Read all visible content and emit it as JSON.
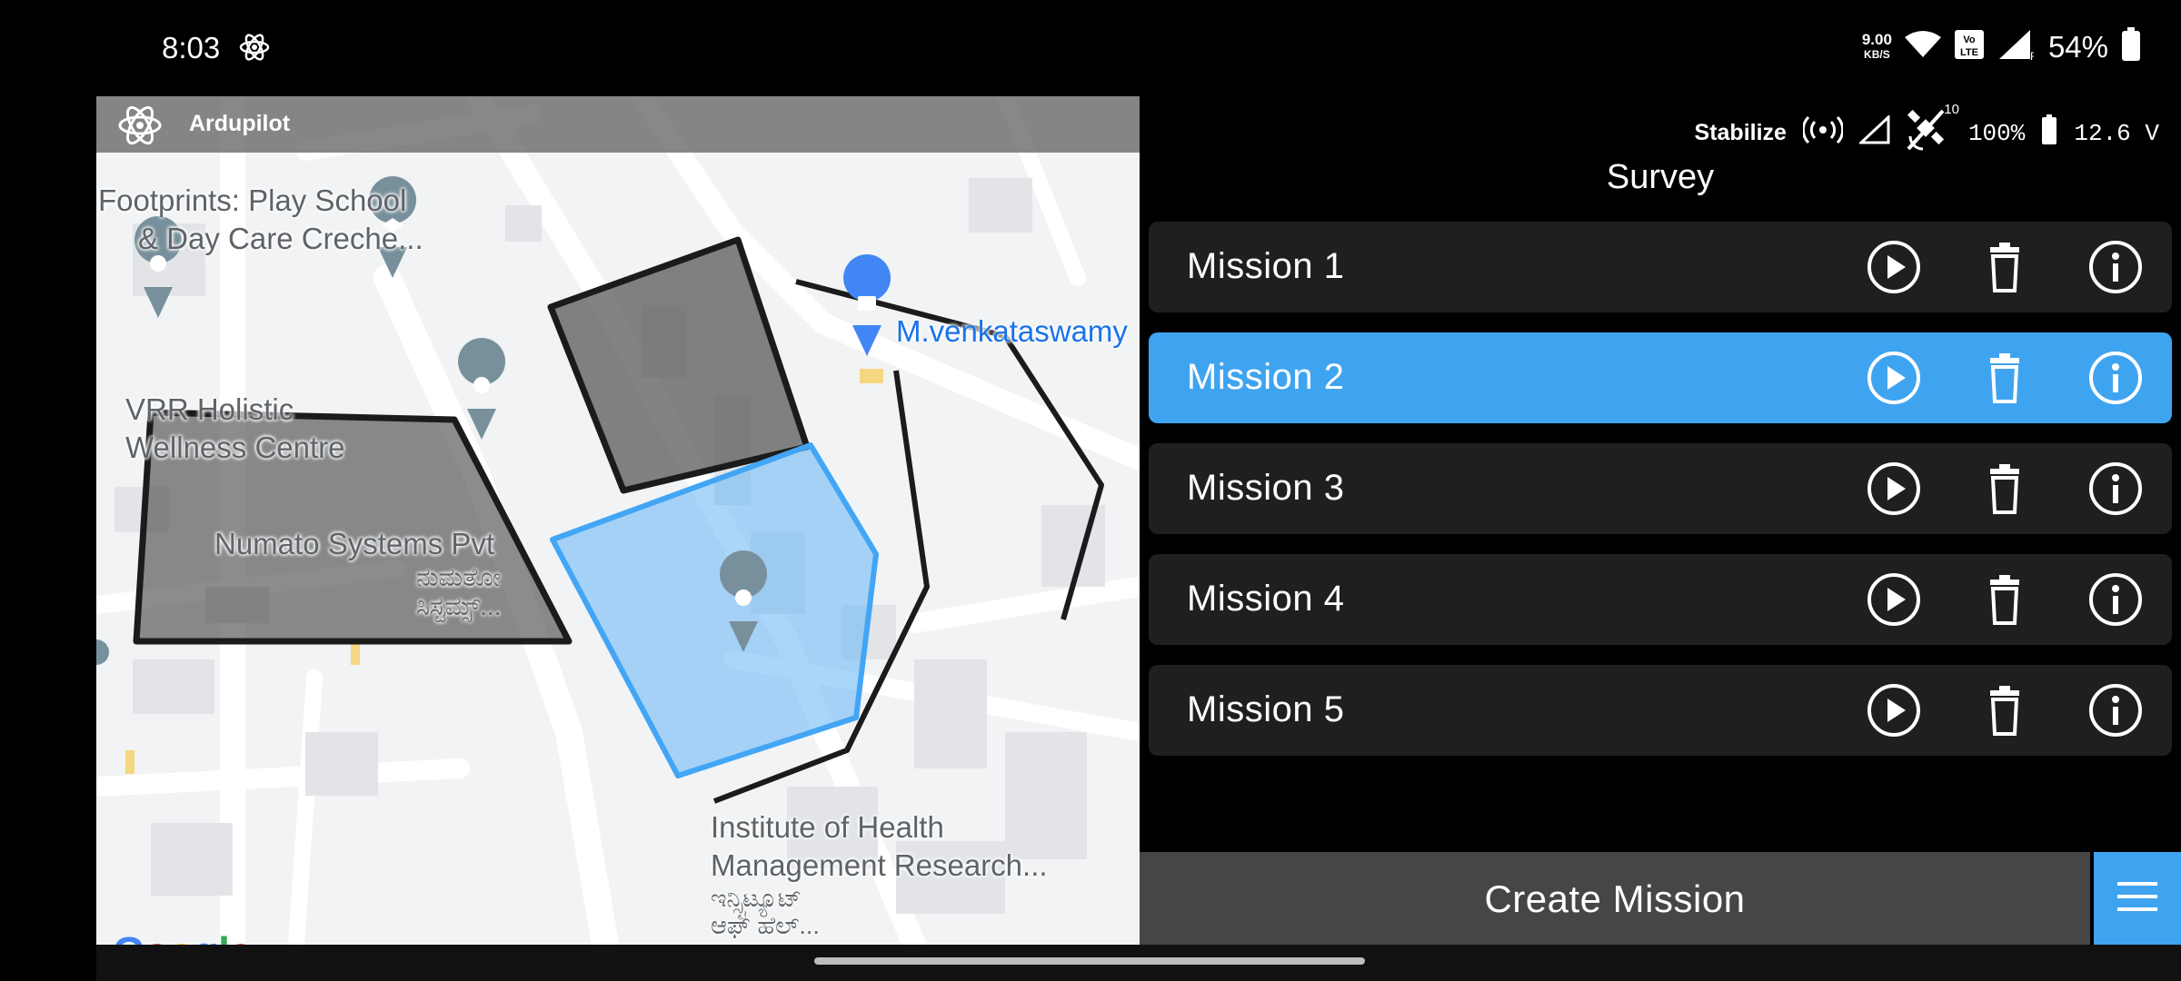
{
  "status_bar": {
    "time": "8:03",
    "speed_value": "9.00",
    "speed_unit": "KB/S",
    "volte": "Vo LTE",
    "roaming": "R",
    "battery": "54%",
    "icons": [
      "atom-icon",
      "wifi-icon",
      "volte-icon",
      "signal-icon",
      "battery-icon"
    ]
  },
  "app": {
    "title": "Ardupilot"
  },
  "telemetry": {
    "mode": "Stabilize",
    "satellites": "10",
    "battery_percent": "100%",
    "voltage": "12.6 V"
  },
  "panel": {
    "title": "Survey",
    "missions": [
      {
        "label": "Mission 1",
        "selected": false
      },
      {
        "label": "Mission 2",
        "selected": true
      },
      {
        "label": "Mission 3",
        "selected": false
      },
      {
        "label": "Mission 4",
        "selected": false
      },
      {
        "label": "Mission 5",
        "selected": false
      }
    ],
    "create_label": "Create Mission"
  },
  "map": {
    "places": {
      "footprints_1": "Footprints: Play School",
      "footprints_2": "& Day Care Creche...",
      "vrr_1": "VRR Holistic",
      "vrr_2": "Wellness Centre",
      "numato_1": "Numato Systems Pvt",
      "numato_2": "ನುಮತೋ",
      "numato_3": "ಸಿಸ್ಟಮ್ಸ್...",
      "venkat": "M.venkataswamy",
      "institute_1": "Institute of Health",
      "institute_2": "Management Research...",
      "institute_3": "ಇನ್ಸ್ಟಿಟ್ಯೂಟ್",
      "institute_4": "ಆಫ್ ಹೆಲ್..."
    },
    "logo": "Google"
  },
  "colors": {
    "accent": "#3fa4f0",
    "row_bg": "#1f1f1f",
    "create_bg": "#464646",
    "polygon_selected": "#42a5f5"
  }
}
